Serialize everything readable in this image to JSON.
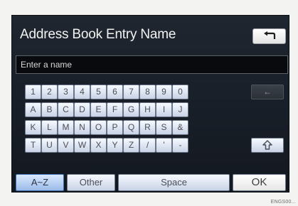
{
  "header": {
    "title": "Address Book Entry Name"
  },
  "name_input": {
    "placeholder": "Enter a name"
  },
  "keyboard": {
    "rows": [
      [
        "1",
        "2",
        "3",
        "4",
        "5",
        "6",
        "7",
        "8",
        "9",
        "0"
      ],
      [
        "A",
        "B",
        "C",
        "D",
        "E",
        "F",
        "G",
        "H",
        "I",
        "J"
      ],
      [
        "K",
        "L",
        "M",
        "N",
        "O",
        "P",
        "Q",
        "R",
        "S",
        "&"
      ],
      [
        "T",
        "U",
        "V",
        "W",
        "X",
        "Y",
        "Z",
        "/",
        "'",
        "-"
      ]
    ],
    "delete_key": "←"
  },
  "bottom_bar": {
    "mode_az": "A~Z",
    "mode_other": "Other",
    "space": "Space",
    "ok": "OK"
  },
  "image_code": "ENGS00..."
}
